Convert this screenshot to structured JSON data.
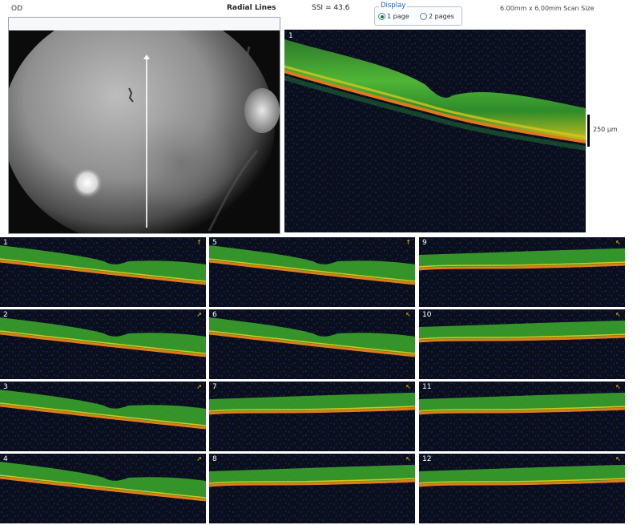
{
  "header": {
    "eye": "OD",
    "scan_pattern": "Radial Lines",
    "ssi": "SSI = 43.6",
    "scan_size": "6.00mm x 6.00mm Scan Size"
  },
  "display": {
    "legend": "Display",
    "options": [
      {
        "label": "1 page",
        "selected": true
      },
      {
        "label": "2 pages",
        "selected": false
      }
    ]
  },
  "main_scan": {
    "number": "1",
    "scale_label": "250 µm"
  },
  "thumbnails": [
    {
      "number": "1",
      "arrow": "↑",
      "shape": "pit"
    },
    {
      "number": "2",
      "arrow": "↗",
      "shape": "pit"
    },
    {
      "number": "3",
      "arrow": "↗",
      "shape": "pit"
    },
    {
      "number": "4",
      "arrow": "↗",
      "shape": "pit"
    },
    {
      "number": "5",
      "arrow": "↑",
      "shape": "pit"
    },
    {
      "number": "6",
      "arrow": "↖",
      "shape": "pit"
    },
    {
      "number": "7",
      "arrow": "↖",
      "shape": "flat"
    },
    {
      "number": "8",
      "arrow": "↖",
      "shape": "flat"
    },
    {
      "number": "9",
      "arrow": "↖",
      "shape": "flat"
    },
    {
      "number": "10",
      "arrow": "↖",
      "shape": "flat"
    },
    {
      "number": "11",
      "arrow": "↖",
      "shape": "flat"
    },
    {
      "number": "12",
      "arrow": "↖",
      "shape": "flat"
    }
  ],
  "colors": {
    "oct_background": "#0a0e1f",
    "retina_green": "#3aa32a",
    "rpe_yellow": "#d7c51a",
    "rpe_orange": "#e07a1d"
  }
}
